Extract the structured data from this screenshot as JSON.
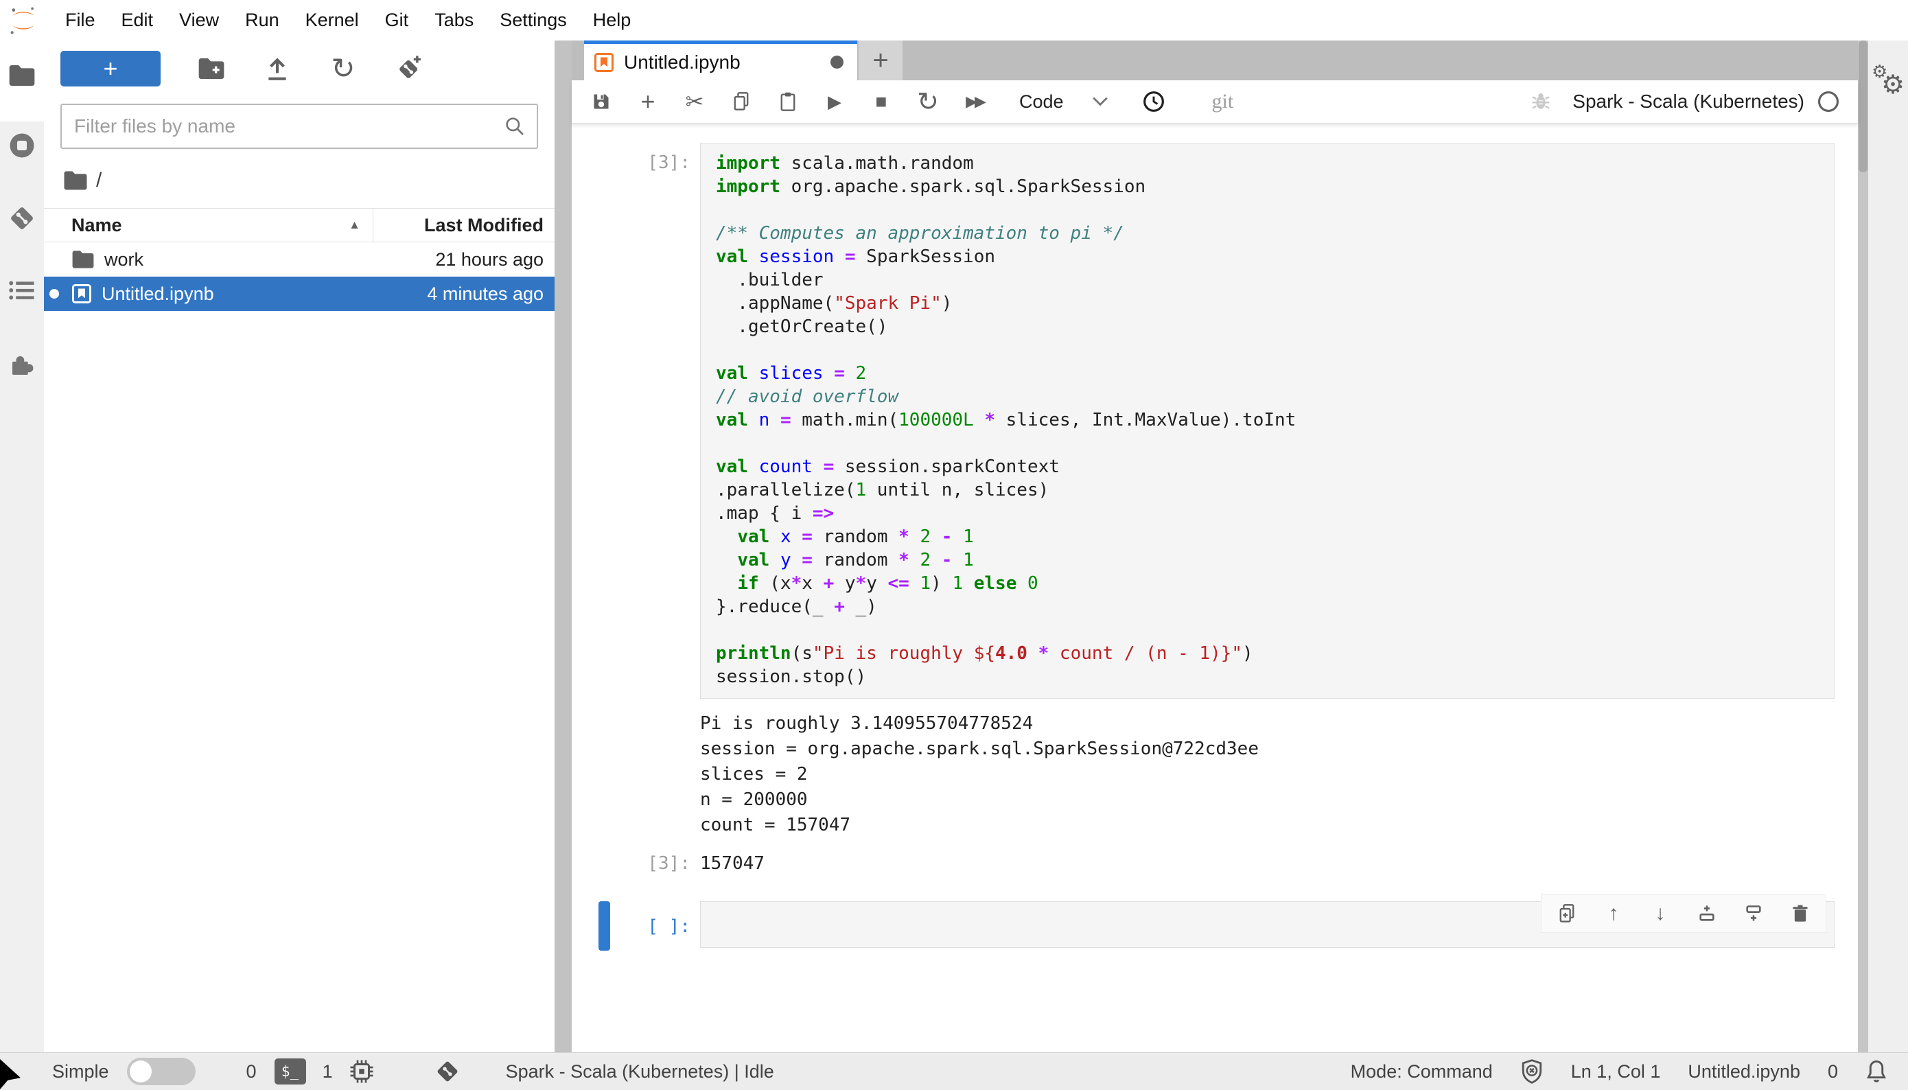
{
  "colors": {
    "accent_blue": "#3276c3",
    "tab_accent": "#2b7de1",
    "cell_select_blue": "#2e7bcf",
    "tabbar_gray": "#bdbdbd",
    "cell_bg": "#f5f5f5",
    "icon_gray": "#616161",
    "kw_green": "#008000",
    "def_blue": "#0000ff",
    "op_purple": "#aa22ff",
    "comment_teal": "#408080",
    "string_red": "#ba2121",
    "number_green": "#008800"
  },
  "icons": {
    "jupyter-logo": "orange double-arc",
    "new-launcher": "+",
    "new-folder": "folder+",
    "upload": "arrow-up-bar",
    "refresh": "↻",
    "git-clone": "diamond+",
    "search": "magnifier",
    "sort-asc": "▲",
    "folder": "folder",
    "notebook": "bookmark-square",
    "save": "floppy",
    "add-cell": "+",
    "cut": "✂",
    "copy": "double-rect",
    "paste": "clipboard",
    "run": "▶",
    "stop": "■",
    "restart": "↻",
    "run-all": "▶▶",
    "chevron-down": "v",
    "clock": "clock",
    "bug": "bug",
    "kernel-idle": "circle",
    "duplicate": "rect+",
    "move-up": "↑",
    "move-down": "↓",
    "insert-above": "+bar",
    "insert-below": "bar+",
    "delete": "trash",
    "terminals": "$_",
    "kernels": "chip",
    "git": "diamond",
    "shield": "shield-x",
    "bell": "bell",
    "gears": "⚙⚙",
    "stop-circle": "circle-square",
    "toc": "list",
    "extensions": "puzzle"
  },
  "menubar": {
    "items": [
      "File",
      "Edit",
      "View",
      "Run",
      "Kernel",
      "Git",
      "Tabs",
      "Settings",
      "Help"
    ]
  },
  "file_browser": {
    "new_launcher_label": "+",
    "filter_placeholder": "Filter files by name",
    "breadcrumb_root": "/",
    "header": {
      "name": "Name",
      "last_modified": "Last Modified"
    },
    "rows": [
      {
        "name": "work",
        "modified": "21 hours ago",
        "icon": "folder-icon",
        "selected": false,
        "running": false
      },
      {
        "name": "Untitled.ipynb",
        "modified": "4 minutes ago",
        "icon": "notebook-icon",
        "selected": true,
        "running": true
      }
    ]
  },
  "notebook": {
    "tab": {
      "title": "Untitled.ipynb"
    },
    "toolbar": {
      "cell_type": "Code",
      "git_label": "git",
      "kernel_name": "Spark - Scala (Kubernetes)"
    },
    "cell": {
      "prompt": "[3]:",
      "source": [
        [
          [
            "kw",
            "import"
          ],
          [
            "pl",
            " scala.math.random"
          ]
        ],
        [
          [
            "kw",
            "import"
          ],
          [
            "pl",
            " org.apache.spark.sql.SparkSession"
          ]
        ],
        [],
        [
          [
            "cm",
            "/** Computes an approximation to pi */"
          ]
        ],
        [
          [
            "kw",
            "val"
          ],
          [
            "pl",
            " "
          ],
          [
            "df",
            "session"
          ],
          [
            "pl",
            " "
          ],
          [
            "op",
            "="
          ],
          [
            "pl",
            " SparkSession"
          ]
        ],
        [
          [
            "pl",
            "  .builder"
          ]
        ],
        [
          [
            "pl",
            "  .appName("
          ],
          [
            "st",
            "\"Spark Pi\""
          ],
          [
            "pl",
            ")"
          ]
        ],
        [
          [
            "pl",
            "  .getOrCreate()"
          ]
        ],
        [],
        [
          [
            "kw",
            "val"
          ],
          [
            "pl",
            " "
          ],
          [
            "df",
            "slices"
          ],
          [
            "pl",
            " "
          ],
          [
            "op",
            "="
          ],
          [
            "pl",
            " "
          ],
          [
            "nu",
            "2"
          ]
        ],
        [
          [
            "cm",
            "// avoid overflow"
          ]
        ],
        [
          [
            "kw",
            "val"
          ],
          [
            "pl",
            " "
          ],
          [
            "df",
            "n"
          ],
          [
            "pl",
            " "
          ],
          [
            "op",
            "="
          ],
          [
            "pl",
            " math.min("
          ],
          [
            "nu",
            "100000L"
          ],
          [
            "pl",
            " "
          ],
          [
            "op",
            "*"
          ],
          [
            "pl",
            " slices, Int.MaxValue).toInt"
          ]
        ],
        [],
        [
          [
            "kw",
            "val"
          ],
          [
            "pl",
            " "
          ],
          [
            "df",
            "count"
          ],
          [
            "pl",
            " "
          ],
          [
            "op",
            "="
          ],
          [
            "pl",
            " session.sparkContext"
          ]
        ],
        [
          [
            "pl",
            ".parallelize("
          ],
          [
            "nu",
            "1"
          ],
          [
            "pl",
            " until n, slices)"
          ]
        ],
        [
          [
            "pl",
            ".map { i "
          ],
          [
            "op",
            "=>"
          ]
        ],
        [
          [
            "pl",
            "  "
          ],
          [
            "kw",
            "val"
          ],
          [
            "pl",
            " "
          ],
          [
            "df",
            "x"
          ],
          [
            "pl",
            " "
          ],
          [
            "op",
            "="
          ],
          [
            "pl",
            " random "
          ],
          [
            "op",
            "*"
          ],
          [
            "pl",
            " "
          ],
          [
            "nu",
            "2"
          ],
          [
            "pl",
            " "
          ],
          [
            "op",
            "-"
          ],
          [
            "pl",
            " "
          ],
          [
            "nu",
            "1"
          ]
        ],
        [
          [
            "pl",
            "  "
          ],
          [
            "kw",
            "val"
          ],
          [
            "pl",
            " "
          ],
          [
            "df",
            "y"
          ],
          [
            "pl",
            " "
          ],
          [
            "op",
            "="
          ],
          [
            "pl",
            " random "
          ],
          [
            "op",
            "*"
          ],
          [
            "pl",
            " "
          ],
          [
            "nu",
            "2"
          ],
          [
            "pl",
            " "
          ],
          [
            "op",
            "-"
          ],
          [
            "pl",
            " "
          ],
          [
            "nu",
            "1"
          ]
        ],
        [
          [
            "pl",
            "  "
          ],
          [
            "kw",
            "if"
          ],
          [
            "pl",
            " (x"
          ],
          [
            "op",
            "*"
          ],
          [
            "pl",
            "x "
          ],
          [
            "op",
            "+"
          ],
          [
            "pl",
            " y"
          ],
          [
            "op",
            "*"
          ],
          [
            "pl",
            "y "
          ],
          [
            "op",
            "<="
          ],
          [
            "pl",
            " "
          ],
          [
            "nu",
            "1"
          ],
          [
            "pl",
            ") "
          ],
          [
            "nu",
            "1"
          ],
          [
            "pl",
            " "
          ],
          [
            "kw",
            "else"
          ],
          [
            "pl",
            " "
          ],
          [
            "nu",
            "0"
          ]
        ],
        [
          [
            "pl",
            "}.reduce(_ "
          ],
          [
            "op",
            "+"
          ],
          [
            "pl",
            " _)"
          ]
        ],
        [],
        [
          [
            "kw",
            "println"
          ],
          [
            "pl",
            "(s"
          ],
          [
            "st",
            "\"Pi is roughly ${"
          ],
          [
            "stb",
            "4.0"
          ],
          [
            "st",
            " "
          ],
          [
            "op",
            "*"
          ],
          [
            "st",
            " count / (n - 1)}\""
          ],
          [
            "pl",
            ")"
          ]
        ],
        [
          [
            "pl",
            "session.stop()"
          ]
        ]
      ]
    },
    "outputs": [
      "Pi is roughly 3.140955704778524",
      "session = org.apache.spark.sql.SparkSession@722cd3ee",
      "slices = 2",
      "n = 200000",
      "count = 157047"
    ],
    "result": {
      "prompt": "[3]:",
      "value": "157047"
    },
    "empty_cell": {
      "prompt": "[ ]:"
    }
  },
  "status_bar": {
    "simple_label": "Simple",
    "terminals_count": "0",
    "kernels_count": "1",
    "kernel_status": "Spark - Scala (Kubernetes) | Idle",
    "mode": "Mode: Command",
    "position": "Ln 1, Col 1",
    "filename": "Untitled.ipynb",
    "notifications_count": "0"
  }
}
